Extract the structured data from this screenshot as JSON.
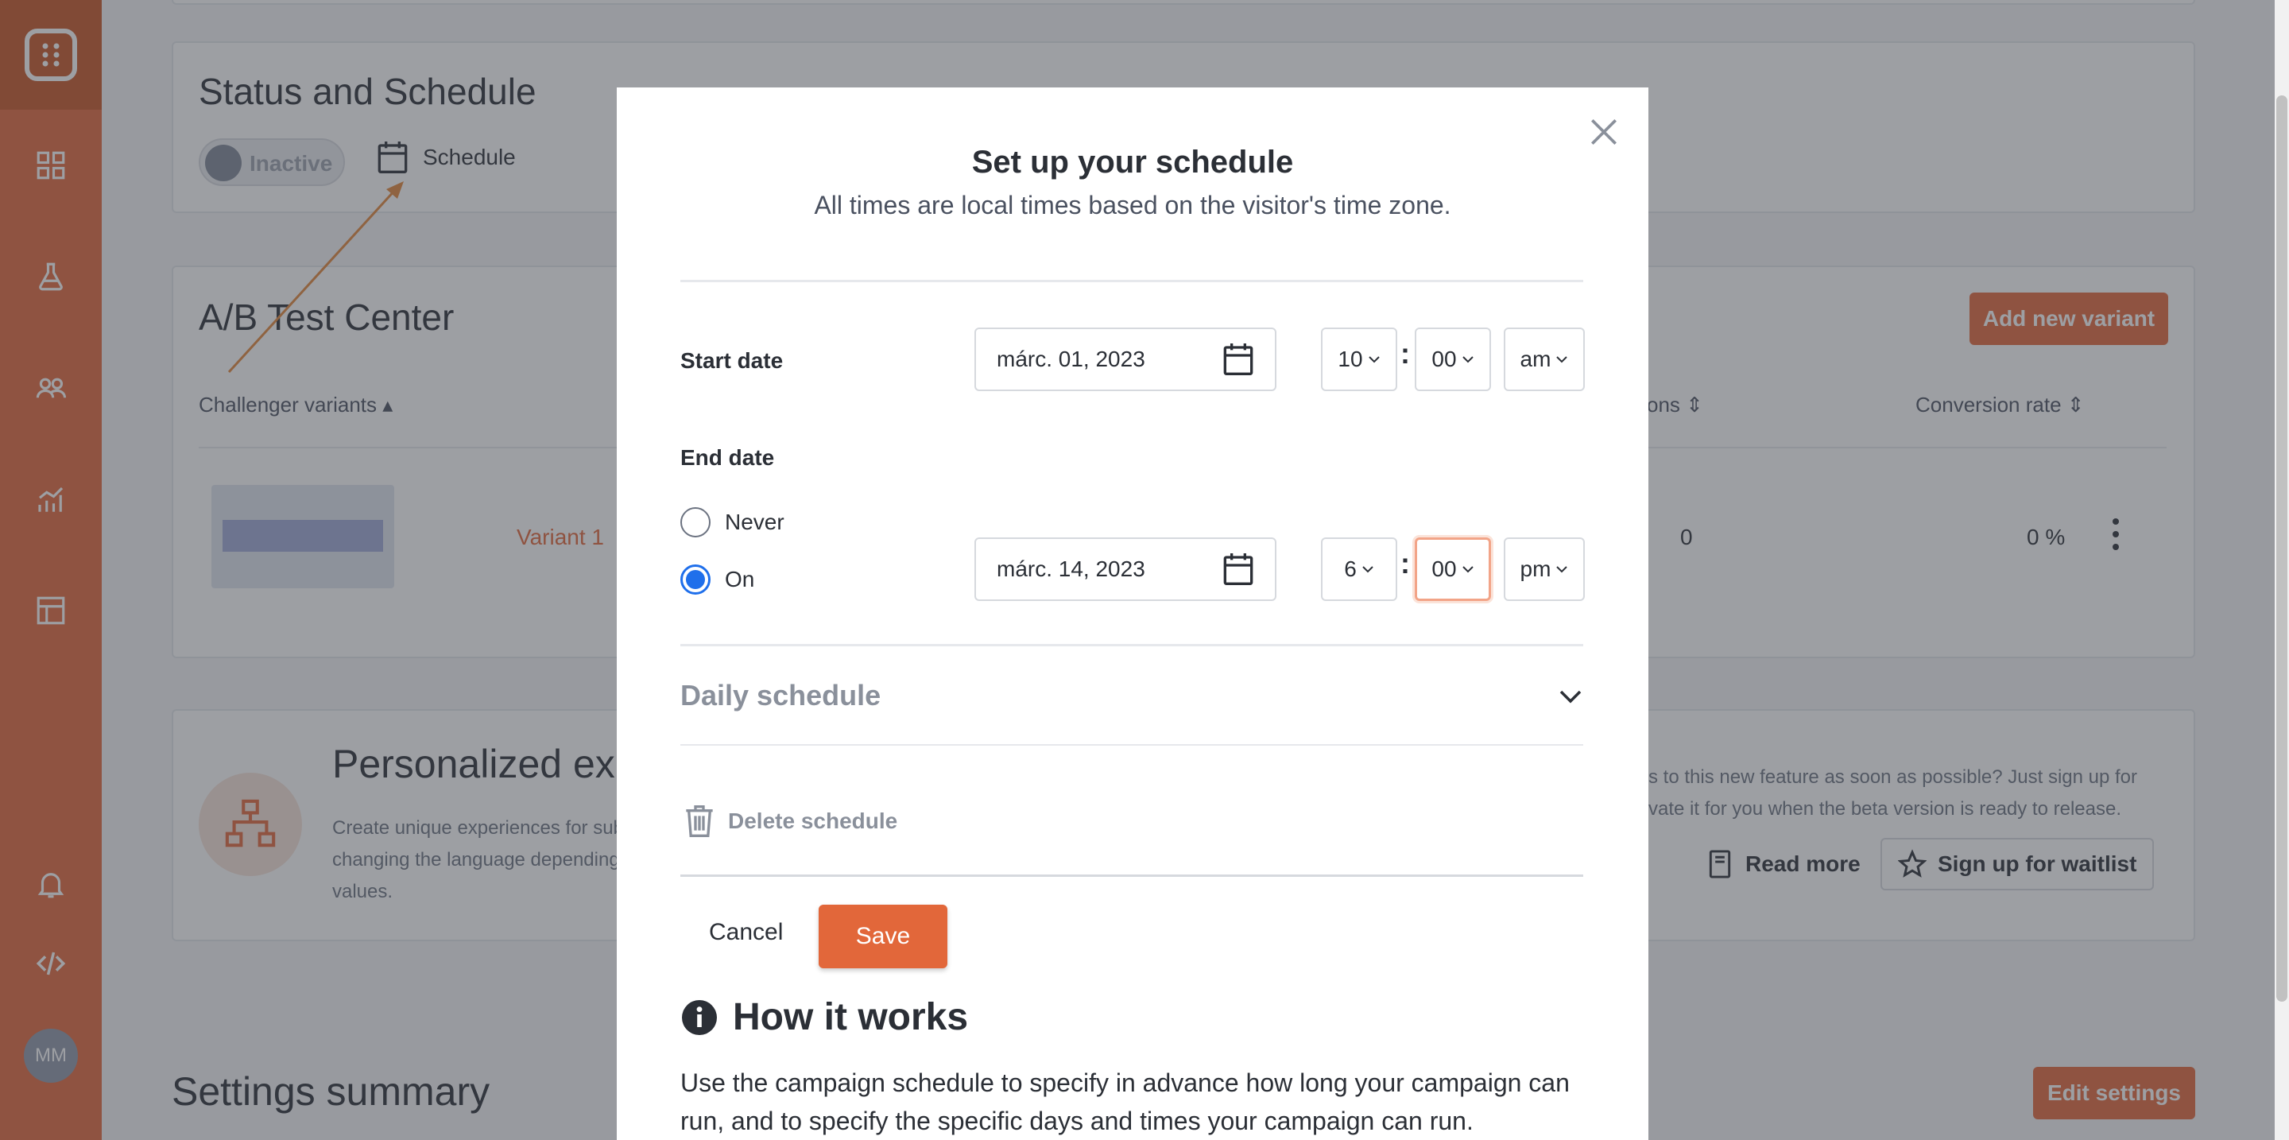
{
  "sidebar": {
    "avatar_initials": "MM",
    "items": [
      {
        "icon": "grid-icon"
      },
      {
        "icon": "flask-icon"
      },
      {
        "icon": "users-icon"
      },
      {
        "icon": "analytics-icon"
      },
      {
        "icon": "layout-icon"
      },
      {
        "icon": "bell-icon"
      },
      {
        "icon": "code-icon"
      }
    ]
  },
  "status_card": {
    "title": "Status and Schedule",
    "toggle_label": "Inactive",
    "schedule_link": "Schedule"
  },
  "ab_card": {
    "title": "A/B Test Center",
    "add_variant_button": "Add new variant",
    "columns": {
      "challenger": "Challenger variants",
      "conversions": "ons",
      "conversion_rate": "Conversion rate"
    },
    "rows": [
      {
        "name": "Variant 1",
        "conversions": "0",
        "conversion_rate": "0 %"
      }
    ]
  },
  "personalized_card": {
    "title": "Personalized exp",
    "left_text": [
      "Create unique experiences for sub",
      "changing the language depending",
      "values."
    ],
    "right_text": [
      "s to this new feature as soon as possible? Just sign up for",
      "vate it for you when the beta version is ready to release."
    ],
    "read_more": "Read more",
    "waitlist": "Sign up for waitlist"
  },
  "settings_summary": {
    "title": "Settings summary",
    "edit_button": "Edit settings"
  },
  "modal": {
    "title": "Set up your schedule",
    "subtitle": "All times are local times based on the visitor's time zone.",
    "start": {
      "label": "Start date",
      "date": "márc. 01, 2023",
      "hour": "10",
      "minute": "00",
      "ampm": "am"
    },
    "end": {
      "label": "End date",
      "never_label": "Never",
      "on_label": "On",
      "selected": "On",
      "date": "márc. 14, 2023",
      "hour": "6",
      "minute": "00",
      "ampm": "pm"
    },
    "daily_schedule": "Daily schedule",
    "delete_schedule": "Delete schedule",
    "cancel": "Cancel",
    "save": "Save",
    "how_title": "How it works",
    "how_text": "Use the campaign schedule to specify in advance how long your campaign can run, and to specify the specific days and times your campaign can run."
  },
  "colors": {
    "brand": "#e2673a",
    "radio_selected": "#1f6feb"
  }
}
